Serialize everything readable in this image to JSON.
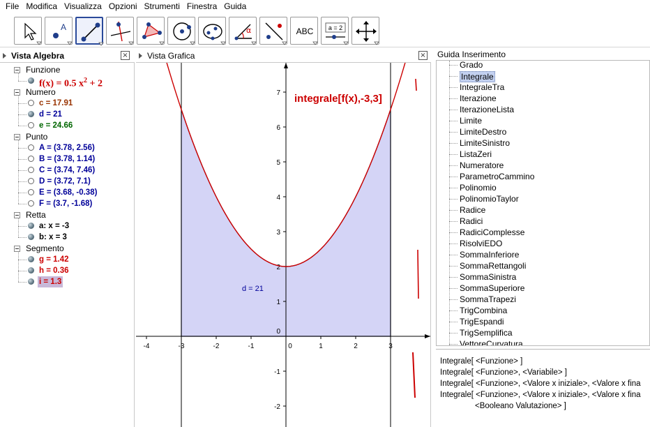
{
  "menu": [
    "File",
    "Modifica",
    "Visualizza",
    "Opzioni",
    "Strumenti",
    "Finestra",
    "Guida"
  ],
  "toolbar": {
    "tools": [
      {
        "icon": "pointer-icon"
      },
      {
        "icon": "new-point-icon",
        "label": "A"
      },
      {
        "icon": "segment-icon",
        "selected": true
      },
      {
        "icon": "perpendicular-line-icon"
      },
      {
        "icon": "polygon-icon"
      },
      {
        "icon": "circle-center-point-icon"
      },
      {
        "icon": "ellipse-icon"
      },
      {
        "icon": "angle-icon",
        "label": "α"
      },
      {
        "icon": "reflect-point-icon"
      },
      {
        "icon": "text-icon",
        "label": "ABC"
      },
      {
        "icon": "slider-icon",
        "label": "a = 2"
      },
      {
        "icon": "move-graphics-icon"
      }
    ]
  },
  "algebra": {
    "title": "Vista Algebra",
    "close": "×",
    "categories": [
      {
        "name": "Funzione",
        "items": [
          {
            "text": "f(x) = 0.5 x",
            "sup": "2",
            "tail": " + 2",
            "color": "#cc0000",
            "filled": true
          }
        ]
      },
      {
        "name": "Numero",
        "items": [
          {
            "text": "c = 17.91",
            "color": "#993300",
            "filled": false
          },
          {
            "text": "d = 21",
            "color": "#000099",
            "filled": true
          },
          {
            "text": "e = 24.66",
            "color": "#006600",
            "filled": false
          }
        ]
      },
      {
        "name": "Punto",
        "items": [
          {
            "text": "A = (3.78, 2.56)",
            "color": "#000099",
            "filled": false
          },
          {
            "text": "B = (3.78, 1.14)",
            "color": "#000099",
            "filled": false
          },
          {
            "text": "C = (3.74, 7.46)",
            "color": "#000099",
            "filled": false
          },
          {
            "text": "D = (3.72, 7.1)",
            "color": "#000099",
            "filled": false
          },
          {
            "text": "E = (3.68, -0.38)",
            "color": "#000099",
            "filled": false
          },
          {
            "text": "F = (3.7, -1.68)",
            "color": "#000099",
            "filled": false
          }
        ]
      },
      {
        "name": "Retta",
        "items": [
          {
            "text": "a: x = -3",
            "color": "#000000",
            "filled": true
          },
          {
            "text": "b: x = 3",
            "color": "#000000",
            "filled": true
          }
        ]
      },
      {
        "name": "Segmento",
        "items": [
          {
            "text": "g = 1.42",
            "color": "#cc0000",
            "filled": true
          },
          {
            "text": "h = 0.36",
            "color": "#cc0000",
            "filled": true
          },
          {
            "text": "i = 1.3",
            "color": "#cc0000",
            "filled": true,
            "selected": true
          }
        ]
      }
    ]
  },
  "graphics": {
    "title": "Vista Grafica",
    "close": "×",
    "integral_label": "integrale[f(x),-3,3]",
    "d_label": "d = 21",
    "x_ticks": [
      "-4",
      "-3",
      "-2",
      "-1",
      "0",
      "1",
      "2",
      "3"
    ],
    "y_ticks": [
      "-2",
      "-1",
      "0",
      "1",
      "2",
      "3",
      "4",
      "5",
      "6",
      "7"
    ],
    "curve_color": "#cc0000",
    "fill_color": "#d4d4f6",
    "line_color": "#1a1a4a"
  },
  "help": {
    "title": "Guida Inserimento",
    "items": [
      "Grado",
      "Integrale",
      "IntegraleTra",
      "Iterazione",
      "IterazioneLista",
      "Limite",
      "LimiteDestro",
      "LimiteSinistro",
      "ListaZeri",
      "Numeratore",
      "ParametroCammino",
      "Polinomio",
      "PolinomioTaylor",
      "Radice",
      "Radici",
      "RadiciComplesse",
      "RisolviEDO",
      "SommaInferiore",
      "SommaRettangoli",
      "SommaSinistra",
      "SommaSuperiore",
      "SommaTrapezi",
      "TrigCombina",
      "TrigEspandi",
      "TrigSemplifica",
      "VettoreCurvatura"
    ],
    "selected_index": 1,
    "syntax": [
      "Integrale[ <Funzione> ]",
      "Integrale[ <Funzione>, <Variabile> ]",
      "Integrale[ <Funzione>, <Valore x iniziale>, <Valore x fina",
      "Integrale[ <Funzione>, <Valore x iniziale>, <Valore x fina",
      "<Booleano Valutazione> ]"
    ]
  }
}
